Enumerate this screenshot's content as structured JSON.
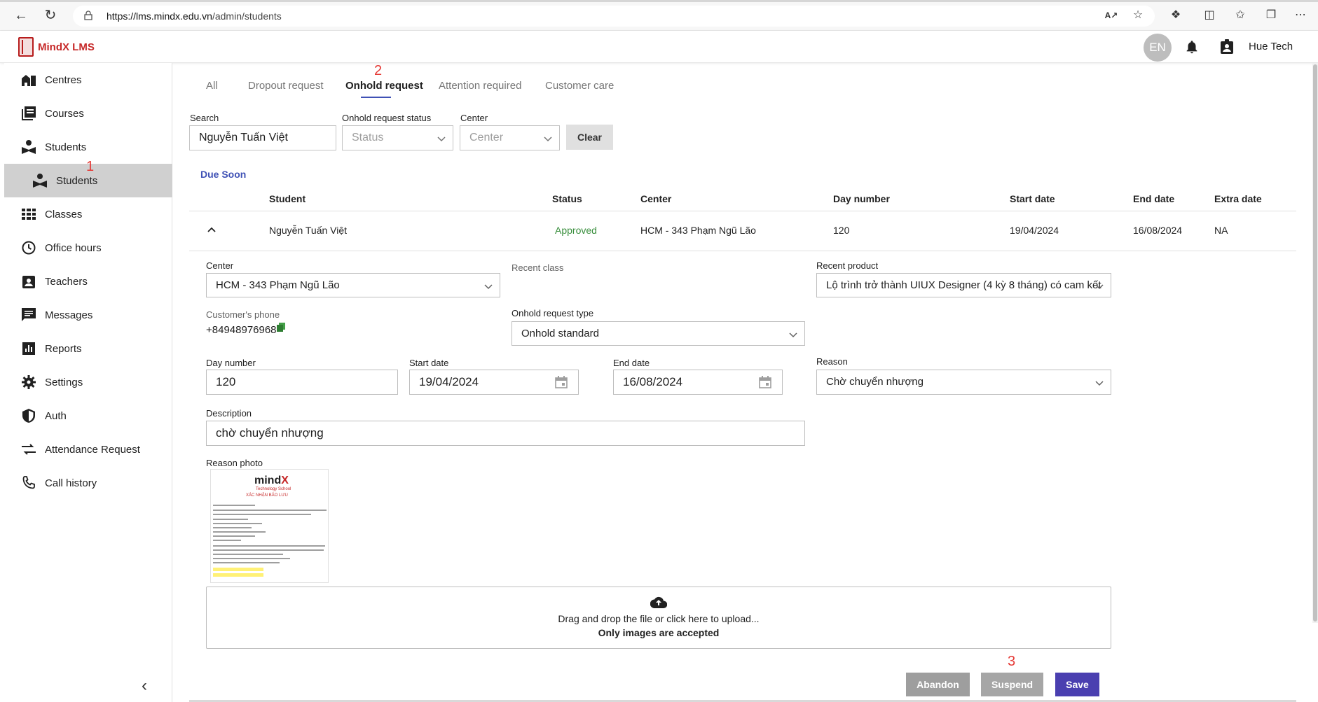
{
  "browser": {
    "url_host": "https://lms.mindx.edu.vn",
    "url_path": "/admin/students"
  },
  "header": {
    "brand": "MindX LMS",
    "language": "EN",
    "user_name": "Hue Tech"
  },
  "sidebar": {
    "items": [
      {
        "label": "Centres",
        "icon": "centres-icon"
      },
      {
        "label": "Courses",
        "icon": "courses-icon"
      },
      {
        "label": "Students",
        "icon": "students-icon"
      },
      {
        "label": "Students",
        "icon": "students-icon"
      },
      {
        "label": "Classes",
        "icon": "classes-icon"
      },
      {
        "label": "Office hours",
        "icon": "clock-icon"
      },
      {
        "label": "Teachers",
        "icon": "teachers-icon"
      },
      {
        "label": "Messages",
        "icon": "messages-icon"
      },
      {
        "label": "Reports",
        "icon": "reports-icon"
      },
      {
        "label": "Settings",
        "icon": "gear-icon"
      },
      {
        "label": "Auth",
        "icon": "shield-icon"
      },
      {
        "label": "Attendance Request",
        "icon": "swap-icon"
      },
      {
        "label": "Call history",
        "icon": "phone-icon"
      }
    ],
    "active_index": 3
  },
  "annotations": {
    "a1": "1",
    "a2": "2",
    "a3": "3"
  },
  "tabs": [
    {
      "label": "All"
    },
    {
      "label": "Dropout request"
    },
    {
      "label": "Onhold request"
    },
    {
      "label": "Attention required"
    },
    {
      "label": "Customer care"
    }
  ],
  "filters": {
    "search_label": "Search",
    "search_value": "Nguyễn Tuấn Việt",
    "status_label": "Onhold request status",
    "status_placeholder": "Status",
    "center_label": "Center",
    "center_placeholder": "Center",
    "clear_label": "Clear"
  },
  "section_label": "Due Soon",
  "table": {
    "columns": [
      "Student",
      "Status",
      "Center",
      "Day number",
      "Start date",
      "End date",
      "Extra date"
    ],
    "row": {
      "student": "Nguyễn Tuấn Việt",
      "status": "Approved",
      "center": "HCM - 343 Phạm Ngũ Lão",
      "day_number": "120",
      "start_date": "19/04/2024",
      "end_date": "16/08/2024",
      "extra_date": "NA"
    }
  },
  "detail": {
    "center_label": "Center",
    "center_value": "HCM - 343 Phạm Ngũ Lão",
    "recent_class_label": "Recent class",
    "recent_product_label": "Recent product",
    "recent_product_value": "Lộ trình trở thành UIUX Designer (4 kỳ 8 tháng) có cam kết",
    "phone_label": "Customer's phone",
    "phone_value": "+84948976968",
    "onhold_type_label": "Onhold request type",
    "onhold_type_value": "Onhold standard",
    "day_number_label": "Day number",
    "day_number_value": "120",
    "start_date_label": "Start date",
    "start_date_value": "19/04/2024",
    "end_date_label": "End date",
    "end_date_value": "16/08/2024",
    "reason_label": "Reason",
    "reason_value": "Chờ chuyển nhượng",
    "description_label": "Description",
    "description_value": "chờ chuyển nhượng",
    "reason_photo_label": "Reason photo",
    "photo_brand_prefix": "mind",
    "photo_brand_x": "X",
    "photo_subtitle": "Technology School",
    "photo_title": "XÁC NHẬN BẢO LƯU"
  },
  "upload": {
    "text": "Drag and drop the file or click here to upload...",
    "note": "Only images are accepted"
  },
  "actions": {
    "abandon": "Abandon",
    "suspend": "Suspend",
    "save": "Save"
  },
  "colors": {
    "accent": "#3f51b5",
    "approved": "#388e3c",
    "brand": "#c62828",
    "abandon_bg": "#9e9e9e",
    "suspend_bg": "#a6a6a6",
    "save_bg": "#4a3fb0"
  }
}
